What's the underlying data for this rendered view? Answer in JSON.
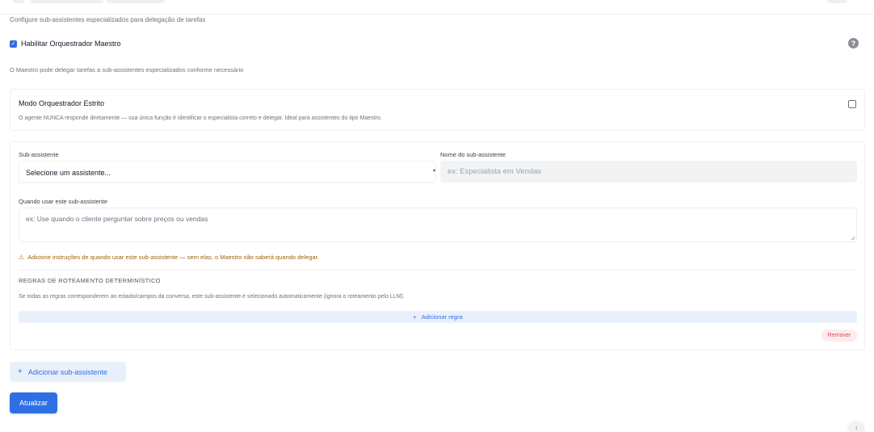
{
  "header": {
    "subtitle": "Configure sub-assistentes especializados para delegação de tarefas"
  },
  "orchestrator": {
    "enable_label": "Habilitar Orquestrador Maestro",
    "enable_checked": true,
    "help_icon": "question-circle-icon",
    "help_glyph": "?",
    "description": "O Maestro pode delegar tarefas a sub-assistentes especializados conforme necessário"
  },
  "strict_mode": {
    "title": "Modo Orquestrador Estrito",
    "description": "O agente NUNCA responde diretamente — sua única função é identificar o especialista correto e delegar. Ideal para assistentes do tipo Maestro.",
    "checked": false
  },
  "sub_assistant": {
    "select_label": "Sub-assistente",
    "select_value": "Selecione um assistente...",
    "name_label": "Nome do sub-assistente",
    "name_placeholder": "ex: Especialista em Vendas",
    "when_label": "Quando usar este sub-assistente",
    "when_placeholder": "ex: Use quando o cliente perguntar sobre preços ou vendas",
    "warning": "Adicione instruções de quando usar este sub-assistente — sem elas, o Maestro não saberá quando delegar.",
    "rules_heading": "REGRAS DE ROTEAMENTO DETERMINÍSTICO",
    "rules_description": "Se todas as regras corresponderem ao estado/campos da conversa, este sub-assistente é selecionado automaticamente (ignora o roteamento pelo LLM).",
    "add_rule_label": "Adicionar regra",
    "remove_label": "Remover"
  },
  "actions": {
    "add_sub_label": "Adicionar sub-assistente",
    "update_label": "Atualizar"
  },
  "colors": {
    "accent": "#2f6fe4",
    "warning": "#a16207",
    "danger": "#d9485a"
  }
}
